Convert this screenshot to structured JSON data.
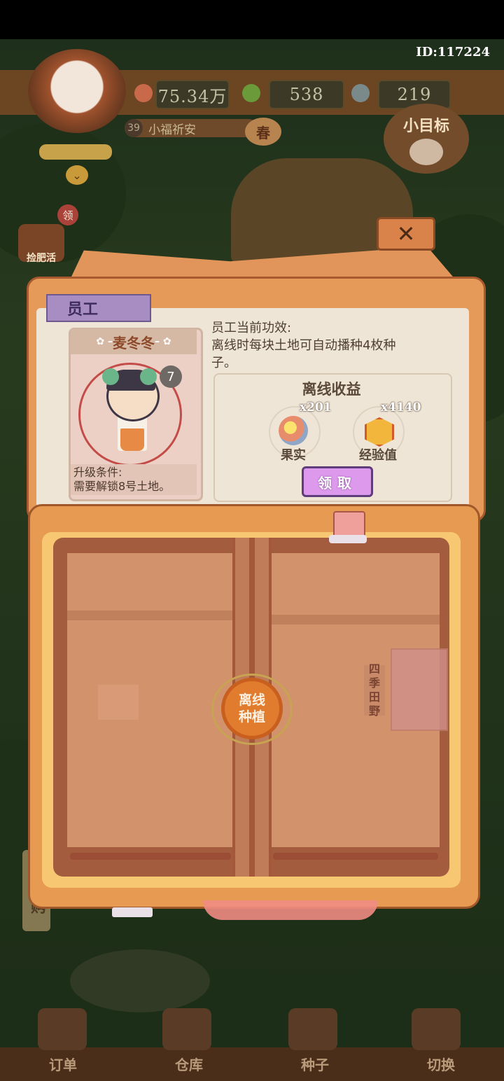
{
  "hud": {
    "player_id": "ID:117224",
    "coins": "75.34万",
    "leaves": "538",
    "timer_value": "219",
    "level": "39",
    "player_name": "小福祈安",
    "season": "春",
    "goal_label": "小目标",
    "chest_label": "捡肥活",
    "chest_badge": "领",
    "side_shop": "阿伯购"
  },
  "colors": {
    "dialog_orange": "#e59a59",
    "paper": "#efe5d6",
    "tab_purple": "#a78dc2",
    "claim_button": "#dd9aec",
    "seal_orange": "#e17b2d"
  },
  "dialog": {
    "close_icon": "close-x-icon",
    "tab_label": "员工",
    "employee": {
      "name": "麦冬冬",
      "level": "7",
      "upgrade_title": "升级条件:",
      "upgrade_text": "需要解锁8号土地。"
    },
    "effect_title": "员工当前功效:",
    "effect_text": "离线时每块土地可自动播种4枚种子。",
    "offline_income": {
      "title": "离线收益",
      "rewards": [
        {
          "qty": "x201",
          "label": "果实",
          "icon": "fruit-basket-icon"
        },
        {
          "qty": "x4140",
          "label": "经验值",
          "icon": "experience-hexagon-icon"
        }
      ],
      "claim_label": "领取"
    }
  },
  "book": {
    "seal_text": "离线种植",
    "side_label": [
      "四",
      "季",
      "田",
      "野"
    ]
  },
  "nav": {
    "items": [
      {
        "label": "订单",
        "icon": "order-clipboard-icon"
      },
      {
        "label": "仓库",
        "icon": "warehouse-icon"
      },
      {
        "label": "种子",
        "icon": "seed-book-icon"
      },
      {
        "label": "切换",
        "icon": "map-switch-icon"
      }
    ]
  }
}
